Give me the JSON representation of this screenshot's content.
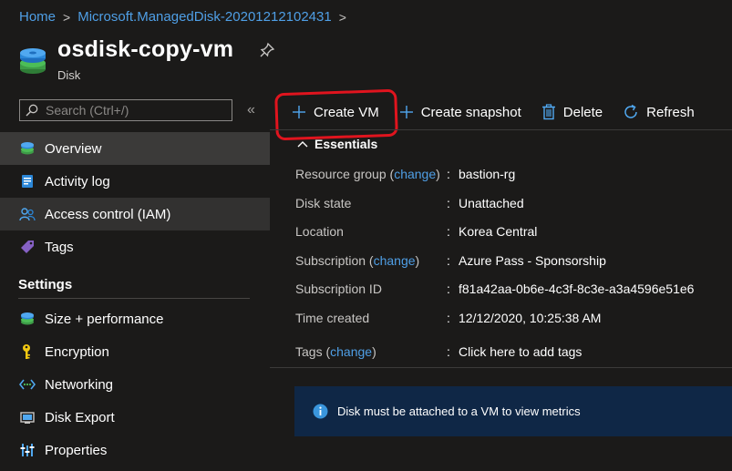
{
  "breadcrumb": {
    "items": [
      "Home",
      "Microsoft.ManagedDisk-20201212102431"
    ],
    "separator": ">"
  },
  "header": {
    "title": "osdisk-copy-vm",
    "subtitle": "Disk"
  },
  "search": {
    "placeholder": "Search (Ctrl+/)"
  },
  "sidebar": {
    "collapse_label": "«",
    "items": [
      {
        "label": "Overview",
        "icon": "disk-icon"
      },
      {
        "label": "Activity log",
        "icon": "activity-log-icon"
      },
      {
        "label": "Access control (IAM)",
        "icon": "people-icon"
      },
      {
        "label": "Tags",
        "icon": "tag-icon"
      }
    ],
    "settings_header": "Settings",
    "settings_items": [
      {
        "label": "Size + performance",
        "icon": "disk-icon"
      },
      {
        "label": "Encryption",
        "icon": "key-icon"
      },
      {
        "label": "Networking",
        "icon": "networking-icon"
      },
      {
        "label": "Disk Export",
        "icon": "export-icon"
      },
      {
        "label": "Properties",
        "icon": "properties-icon"
      }
    ]
  },
  "toolbar": {
    "create_vm": "Create VM",
    "create_snapshot": "Create snapshot",
    "delete": "Delete",
    "refresh": "Refresh"
  },
  "essentials": {
    "header": "Essentials",
    "colon": ":",
    "change_link": "change",
    "rows": [
      {
        "label": "Resource group",
        "value": "bastion-rg"
      },
      {
        "label": "Disk state",
        "value": "Unattached"
      },
      {
        "label": "Location",
        "value": "Korea Central"
      },
      {
        "label": "Subscription",
        "value": "Azure Pass - Sponsorship"
      },
      {
        "label": "Subscription ID",
        "value": "f81a42aa-0b6e-4c3f-8c3e-a3a4596e51e6"
      },
      {
        "label": "Time created",
        "value": "12/12/2020, 10:25:38 AM"
      },
      {
        "label": "Tags",
        "value": "Click here to add tags"
      }
    ]
  },
  "banner": {
    "message": "Disk must be attached to a VM to view metrics"
  },
  "colors": {
    "background": "#1b1a19",
    "link": "#4f9fe6",
    "highlight": "#e0141e",
    "banner": "#0f2746"
  }
}
